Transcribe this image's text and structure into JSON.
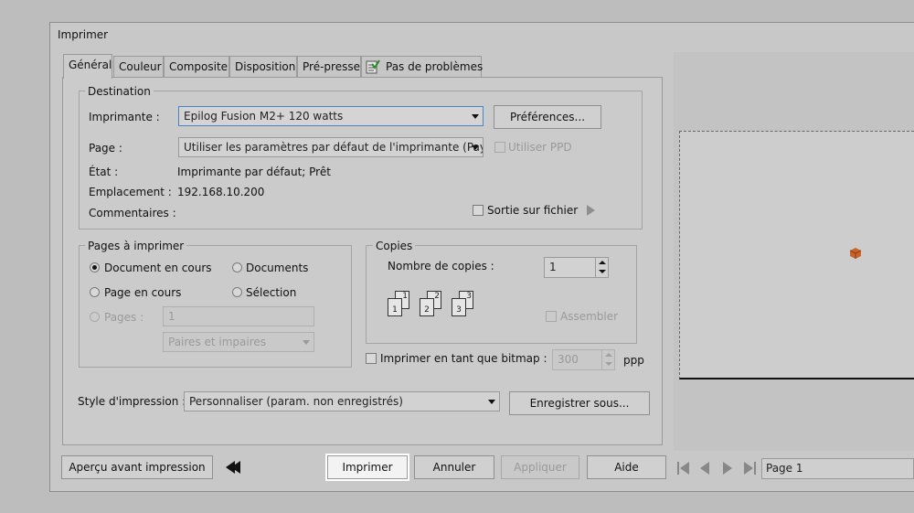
{
  "window": {
    "title": "Imprimer"
  },
  "tabs": [
    "Général",
    "Couleur",
    "Composite",
    "Disposition",
    "Pré-presse",
    "Pas de problèmes"
  ],
  "destination": {
    "legend": "Destination",
    "printer_label": "Imprimante :",
    "printer_value": "Epilog Fusion M2+ 120 watts",
    "preferences_button": "Préférences...",
    "page_label": "Page :",
    "page_value": "Utiliser les paramètres par défaut de l'imprimante (Paysag...",
    "use_ppd_label": "Utiliser PPD",
    "status_label": "État :",
    "status_value": "Imprimante par défaut; Prêt",
    "location_label": "Emplacement :",
    "location_value": "192.168.10.200",
    "comments_label": "Commentaires :",
    "print_to_file_label": "Sortie sur fichier"
  },
  "pages": {
    "legend": "Pages à imprimer",
    "current_document": "Document en cours",
    "documents": "Documents",
    "current_page": "Page en cours",
    "selection": "Sélection",
    "pages_label": "Pages :",
    "pages_value": "1",
    "even_odd_value": "Paires et impaires"
  },
  "copies": {
    "legend": "Copies",
    "count_label": "Nombre de copies :",
    "count_value": "1",
    "collate_label": "Assembler",
    "stack_numbers": [
      "1",
      "1",
      "2",
      "2",
      "3",
      "3"
    ]
  },
  "bitmap": {
    "label": "Imprimer en tant que bitmap :",
    "dpi_value": "300",
    "unit": "ppp"
  },
  "style": {
    "label": "Style d'impression :",
    "value": "Personnaliser (param. non enregistrés)",
    "save_as_button": "Enregistrer sous..."
  },
  "footer": {
    "preview_button": "Aperçu avant impression",
    "print_button": "Imprimer",
    "cancel_button": "Annuler",
    "apply_button": "Appliquer",
    "help_button": "Aide"
  },
  "preview_nav": {
    "page_label": "Page 1"
  },
  "colors": {
    "accent": "#4a84c0",
    "preview_object": "#c8642a"
  }
}
